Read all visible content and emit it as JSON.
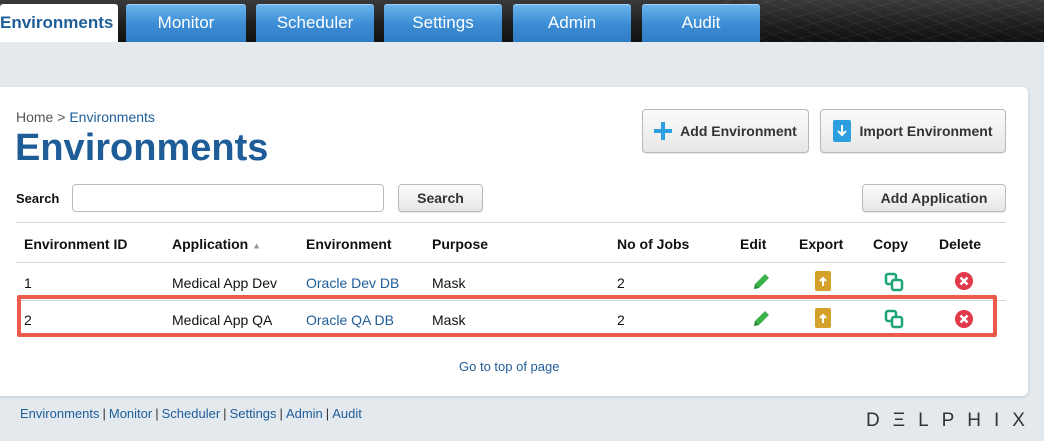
{
  "nav": {
    "tabs": [
      {
        "label": "Environments",
        "active": true
      },
      {
        "label": "Monitor",
        "active": false
      },
      {
        "label": "Scheduler",
        "active": false
      },
      {
        "label": "Settings",
        "active": false
      },
      {
        "label": "Admin",
        "active": false
      },
      {
        "label": "Audit",
        "active": false
      }
    ]
  },
  "breadcrumb": {
    "home": "Home",
    "separator": ">",
    "current": "Environments"
  },
  "page_title": "Environments",
  "actions": {
    "add_environment": "Add Environment",
    "import_environment": "Import Environment",
    "add_application": "Add Application"
  },
  "search": {
    "label": "Search",
    "value": "",
    "placeholder": "",
    "button": "Search"
  },
  "table": {
    "headers": {
      "env_id": "Environment ID",
      "application": "Application",
      "sort_indicator": "▲",
      "environment": "Environment",
      "purpose": "Purpose",
      "jobs": "No of Jobs",
      "edit": "Edit",
      "export": "Export",
      "copy": "Copy",
      "delete": "Delete"
    },
    "rows": [
      {
        "env_id": "1",
        "application": "Medical App Dev",
        "environment": "Oracle Dev DB",
        "purpose": "Mask",
        "jobs": "2"
      },
      {
        "env_id": "2",
        "application": "Medical App QA",
        "environment": "Oracle QA DB",
        "purpose": "Mask",
        "jobs": "2"
      }
    ]
  },
  "go_top": "Go to top of page",
  "footer": {
    "links": [
      "Environments",
      "Monitor",
      "Scheduler",
      "Settings",
      "Admin",
      "Audit"
    ],
    "separator": "|"
  },
  "brand": "DΞLPHIX",
  "colors": {
    "accent": "#1f5d99",
    "tab_blue": "#3d8fd6",
    "highlight": "#ec5a4c",
    "edit_green": "#3cb34a",
    "export_gold": "#d4a12a",
    "copy_teal": "#1fa37a",
    "delete_red": "#e0394a"
  },
  "icons": {
    "add": "plus-icon",
    "import": "import-icon",
    "edit": "pencil-icon",
    "export": "export-icon",
    "copy": "copy-icon",
    "delete": "delete-icon"
  }
}
